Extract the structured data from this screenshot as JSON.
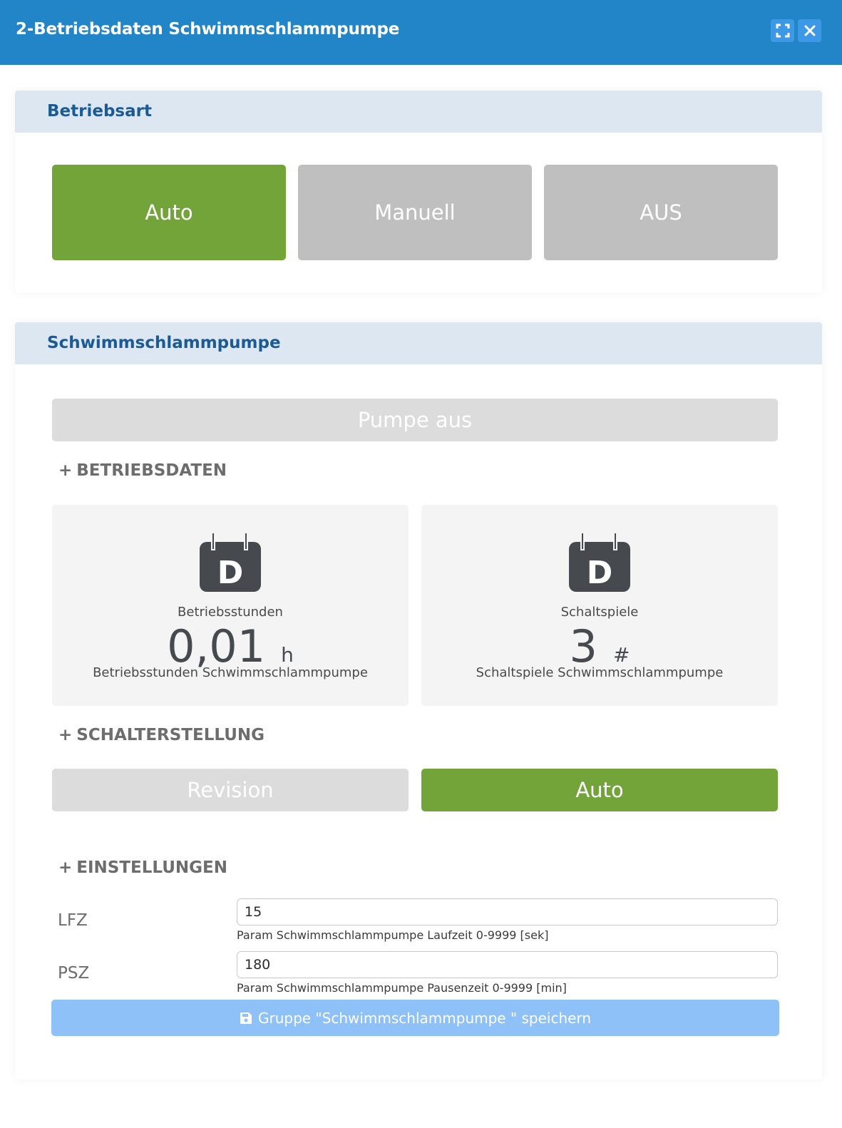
{
  "window": {
    "title": "2-Betriebsdaten Schwimmschlammpumpe",
    "maximize_icon": "maximize-icon",
    "close_icon": "close-icon"
  },
  "betriebsart": {
    "heading": "Betriebsart",
    "buttons": [
      {
        "label": "Auto",
        "active": true
      },
      {
        "label": "Manuell",
        "active": false
      },
      {
        "label": "AUS",
        "active": false
      }
    ]
  },
  "pumpe": {
    "heading": "Schwimmschlammpumpe",
    "status_label": "Pumpe aus",
    "sections": {
      "betriebsdaten": "BETRIEBSDATEN",
      "schalterstellung": "SCHALTERSTELLUNG",
      "einstellungen": "EINSTELLUNGEN"
    },
    "stats": [
      {
        "label": "Betriebsstunden",
        "value": "0,01",
        "unit": "h",
        "description": "Betriebsstunden Schwimmschlammpumpe",
        "icon_letter": "D"
      },
      {
        "label": "Schaltspiele",
        "value": "3",
        "unit": "#",
        "description": "Schaltspiele Schwimmschlammpumpe",
        "icon_letter": "D"
      }
    ],
    "switch": {
      "revision_label": "Revision",
      "auto_label": "Auto",
      "active": "Auto"
    },
    "params": [
      {
        "label": "LFZ",
        "value": "15",
        "help": "Param Schwimmschlammpumpe Laufzeit 0-9999 [sek]"
      },
      {
        "label": "PSZ",
        "value": "180",
        "help": "Param Schwimmschlammpumpe Pausenzeit 0-9999 [min]"
      }
    ],
    "save_label": "Gruppe \"Schwimmschlammpumpe \" speichern"
  },
  "colors": {
    "titlebar": "#2285c8",
    "active_green": "#72a43a",
    "inactive_gray": "#bfbfbf",
    "heading_blue": "#1c5a96",
    "save_blue": "#8ec1f7"
  }
}
